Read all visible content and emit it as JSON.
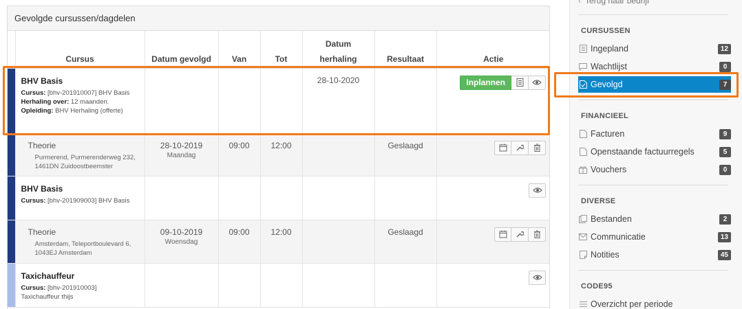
{
  "panel": {
    "title": "Gevolgde cursussen/dagdelen",
    "columns": {
      "cursus": "Cursus",
      "datum_gevolgd": "Datum gevolgd",
      "van": "Van",
      "tot": "Tot",
      "datum_herhaling_1": "Datum",
      "datum_herhaling_2": "herhaling",
      "resultaat": "Resultaat",
      "actie": "Actie"
    },
    "rows": [
      {
        "title": "BHV Basis",
        "strip_color": "#1f3b82",
        "meta": {
          "cursus_label": "Cursus:",
          "cursus_value": " [bhv-201910007] BHV Basis",
          "herhaling_label": "Herhaling over:",
          "herhaling_value": " 12 maanden.",
          "opleiding_label": "Opleiding:",
          "opleiding_value": " BHV Herhaling (offerte)"
        },
        "datum_herhaling": "28-10-2020",
        "inplannen_label": "Inplannen"
      },
      {
        "title": "Theorie",
        "address": "Purmerend, Purmerenderweg 232, 1461DN Zuidoostbeemster",
        "date": "28-10-2019",
        "day": "Maandag",
        "van": "09:00",
        "tot": "12:00",
        "resultaat": "Geslaagd"
      },
      {
        "title": "BHV Basis",
        "strip_color": "#1f3b82",
        "meta": {
          "cursus_label": "Cursus:",
          "cursus_value": " [bhv-201909003] BHV Basis"
        }
      },
      {
        "title": "Theorie",
        "address": "Amsterdam, Teleportboulevard 6, 1043EJ Amsterdam",
        "date": "09-10-2019",
        "day": "Woensdag",
        "van": "09:00",
        "tot": "12:00",
        "resultaat": "Geslaagd"
      },
      {
        "title": "Taxichauffeur",
        "strip_color": "#a9bde8",
        "meta": {
          "cursus_label": "Cursus:",
          "cursus_value": " [bhv-201910003]",
          "line2": "Taxichauffeur thijs"
        }
      }
    ]
  },
  "sidebar": {
    "back_link": "Terug naar bedrijf",
    "sections": [
      {
        "heading": "CURSUSSEN",
        "items": [
          {
            "label": "Ingepland",
            "count": "12",
            "icon": "list-icon"
          },
          {
            "label": "Wachtlijst",
            "count": "0",
            "icon": "chat-icon"
          },
          {
            "label": "Gevolgd",
            "count": "7",
            "icon": "file-check-icon",
            "active": true
          }
        ]
      },
      {
        "heading": "FINANCIEEL",
        "items": [
          {
            "label": "Facturen",
            "count": "9",
            "icon": "document-icon"
          },
          {
            "label": "Openstaande factuurregels",
            "count": "5",
            "icon": "document-icon"
          },
          {
            "label": "Vouchers",
            "count": "0",
            "icon": "gift-icon"
          }
        ]
      },
      {
        "heading": "DIVERSE",
        "items": [
          {
            "label": "Bestanden",
            "count": "2",
            "icon": "files-icon"
          },
          {
            "label": "Communicatie",
            "count": "13",
            "icon": "envelope-icon"
          },
          {
            "label": "Notities",
            "count": "45",
            "icon": "note-icon"
          }
        ]
      },
      {
        "heading": "CODE95",
        "items": [
          {
            "label": "Overzicht per periode",
            "icon": "menu-icon"
          }
        ]
      }
    ]
  },
  "colors": {
    "accent_active": "#0b86c9",
    "highlight": "#f07a1a",
    "success_button": "#5cb85c"
  }
}
